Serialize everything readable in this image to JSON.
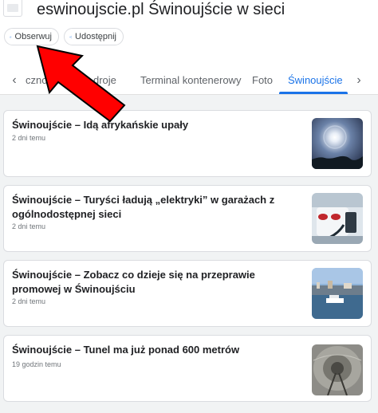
{
  "header": {
    "title": "eswinoujscie.pl Świnoujście w sieci",
    "follow_label": "Obserwuj",
    "share_label": "Udostępnij"
  },
  "tabs": [
    {
      "label": "czno",
      "active": false
    },
    {
      "label": "droje",
      "active": false
    },
    {
      "label": "Terminal kontenerowy",
      "active": false
    },
    {
      "label": "Foto",
      "active": false
    },
    {
      "label": "Świnoujście",
      "active": true
    }
  ],
  "articles": [
    {
      "title": "Świnoujście – Idą afrykańskie upały",
      "time": "2 dni temu",
      "thumb": "sun-halo-sky"
    },
    {
      "title": "Świnoujście – Turyści ładują „elektryki” w garażach z ogólnodostępnej sieci",
      "time": "2 dni temu",
      "thumb": "ev-charging"
    },
    {
      "title": "Świnoujście – Zobacz co dzieje się na przeprawie promowej w Świnoujściu",
      "time": "2 dni temu",
      "thumb": "ferry-harbor"
    },
    {
      "title": "Świnoujście – Tunel ma już ponad 600 metrów",
      "time": "19 godzin temu",
      "thumb": "tunnel"
    }
  ],
  "colors": {
    "accent": "#1a73e8",
    "annotation_arrow": "#ff0000"
  }
}
